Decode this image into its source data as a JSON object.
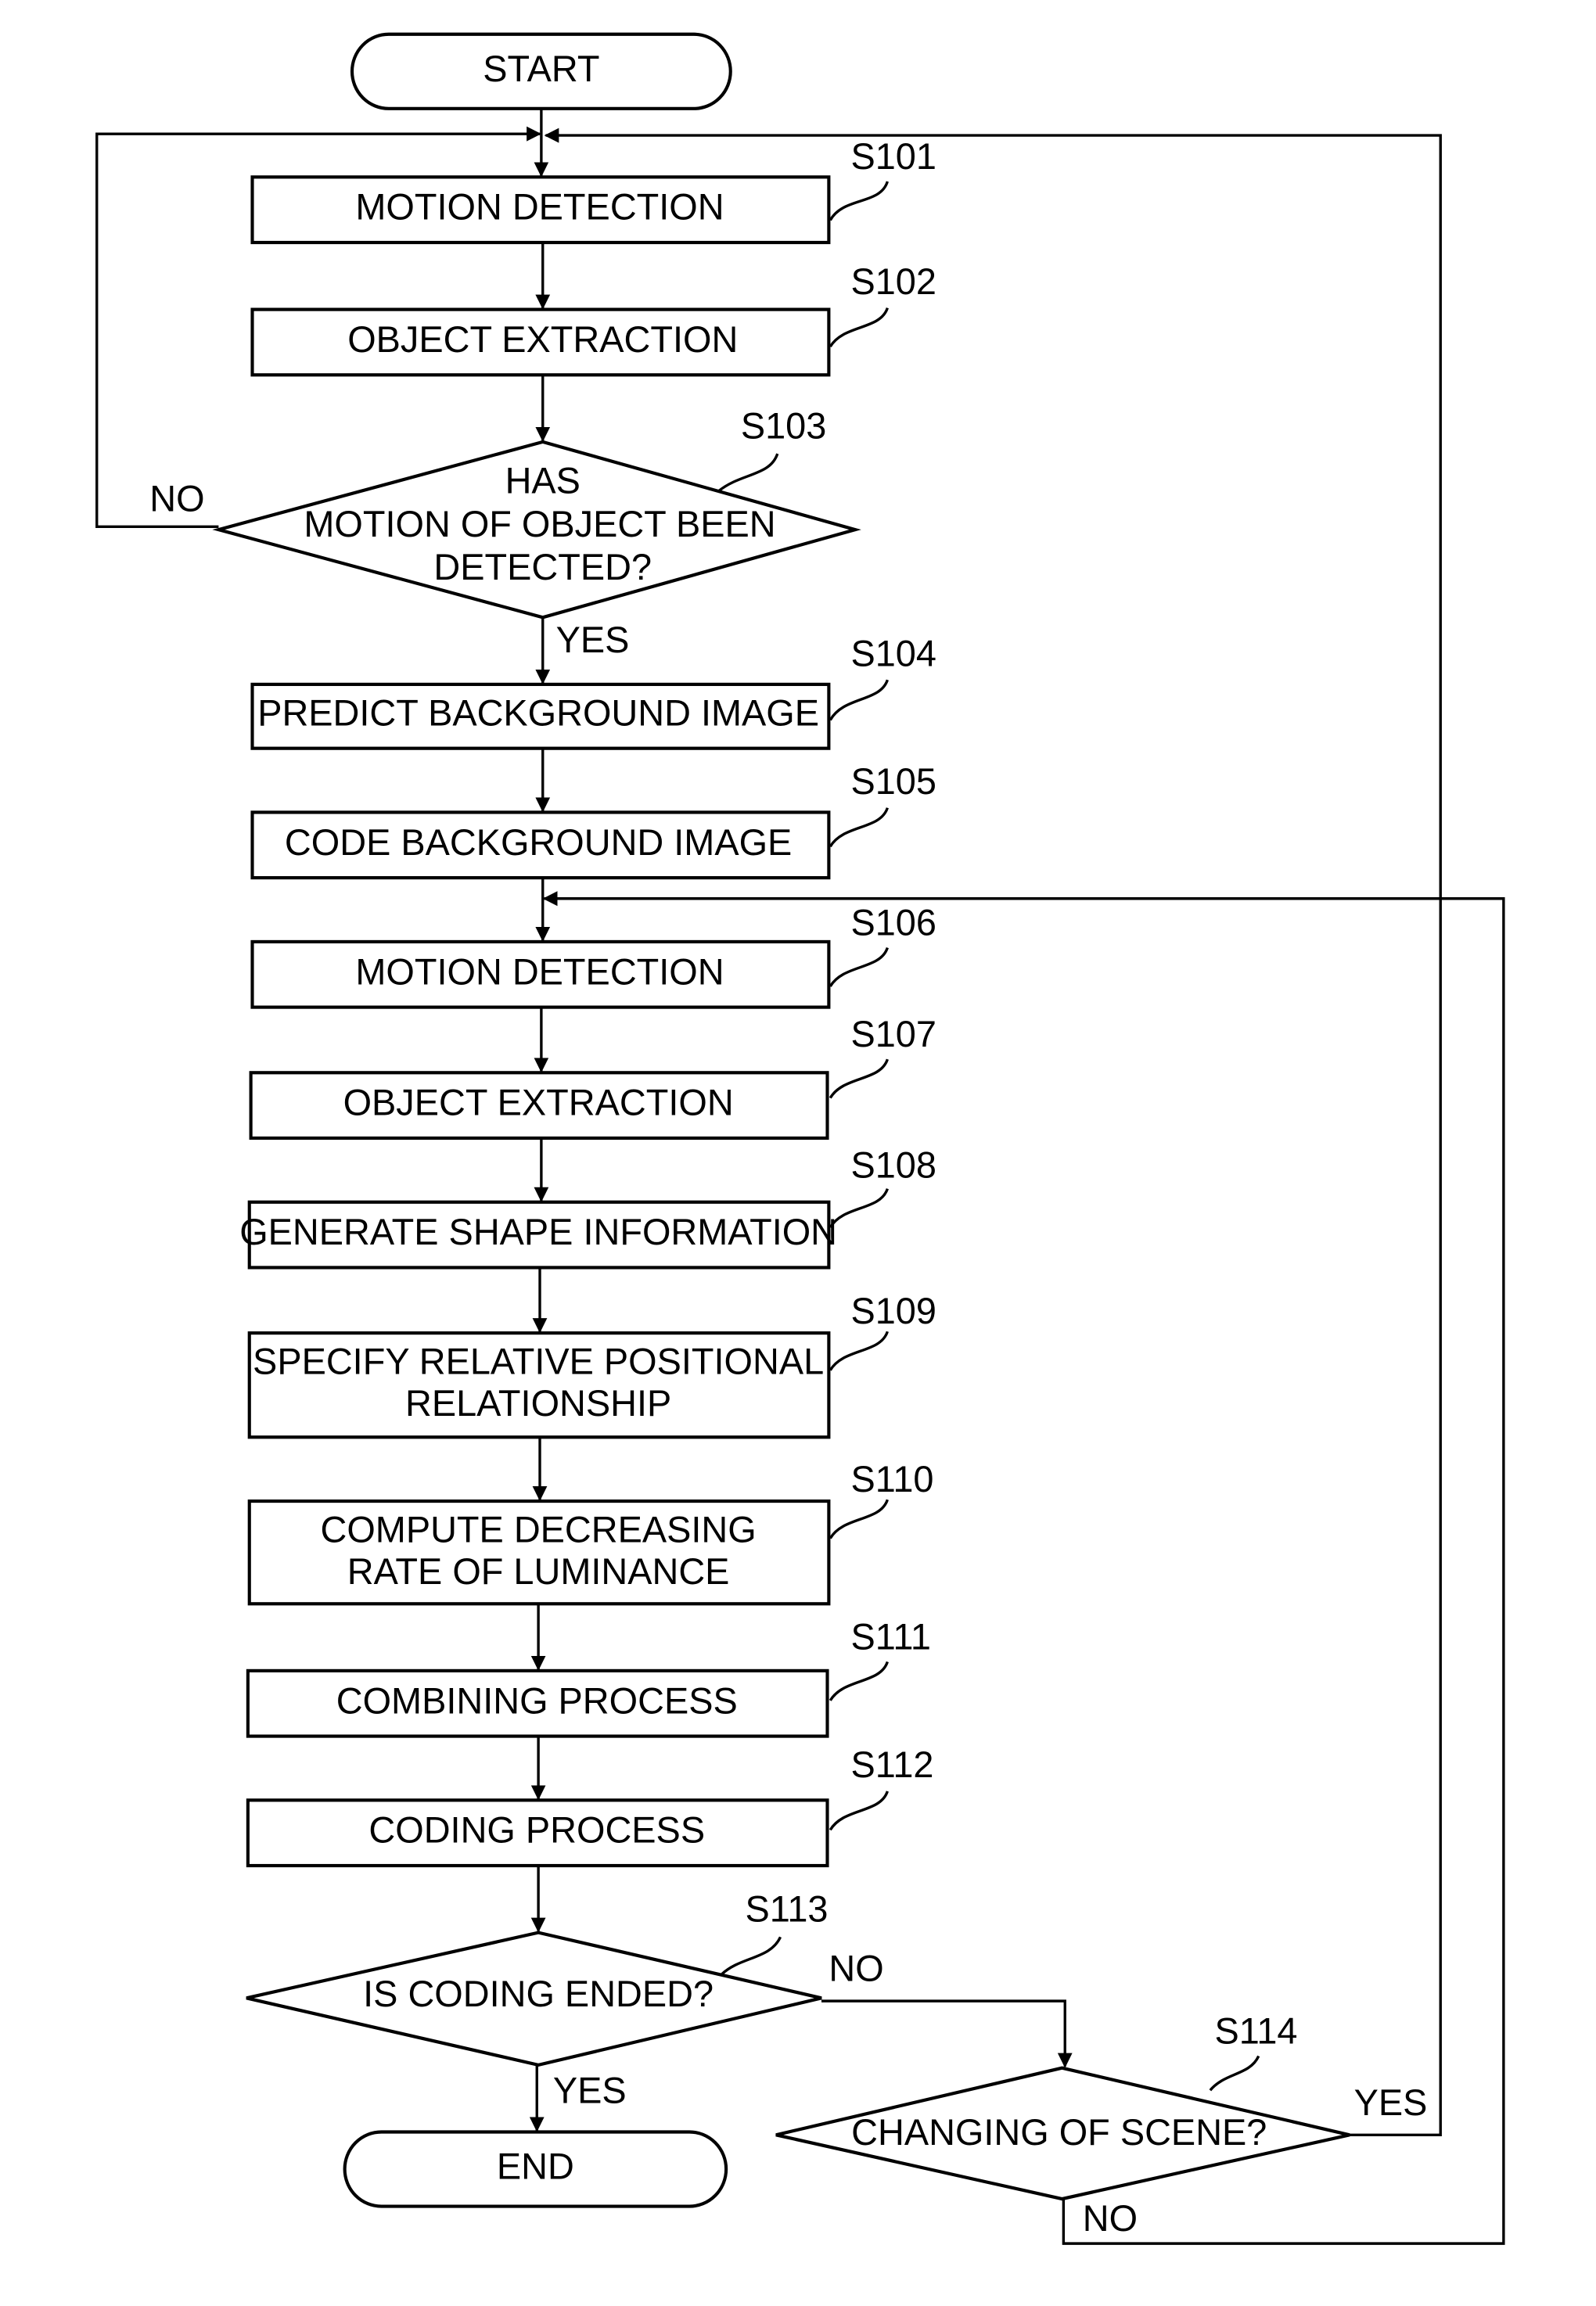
{
  "terminals": {
    "start": "START",
    "end": "END"
  },
  "steps": [
    {
      "id": "S101",
      "lines": [
        "MOTION DETECTION"
      ]
    },
    {
      "id": "S102",
      "lines": [
        "OBJECT EXTRACTION"
      ]
    },
    {
      "id": "S103",
      "lines": [
        "HAS",
        "MOTION OF OBJECT BEEN",
        "DETECTED?"
      ],
      "decision": true
    },
    {
      "id": "S104",
      "lines": [
        "PREDICT BACKGROUND IMAGE"
      ]
    },
    {
      "id": "S105",
      "lines": [
        "CODE BACKGROUND IMAGE"
      ]
    },
    {
      "id": "S106",
      "lines": [
        "MOTION DETECTION"
      ]
    },
    {
      "id": "S107",
      "lines": [
        "OBJECT EXTRACTION"
      ]
    },
    {
      "id": "S108",
      "lines": [
        "GENERATE SHAPE INFORMATION"
      ]
    },
    {
      "id": "S109",
      "lines": [
        "SPECIFY RELATIVE POSITIONAL",
        "RELATIONSHIP"
      ]
    },
    {
      "id": "S110",
      "lines": [
        "COMPUTE DECREASING",
        "RATE OF LUMINANCE"
      ]
    },
    {
      "id": "S111",
      "lines": [
        "COMBINING PROCESS"
      ]
    },
    {
      "id": "S112",
      "lines": [
        "CODING PROCESS"
      ]
    },
    {
      "id": "S113",
      "lines": [
        "IS CODING ENDED?"
      ],
      "decision": true
    },
    {
      "id": "S114",
      "lines": [
        "CHANGING OF SCENE?"
      ],
      "decision": true
    }
  ],
  "branches": {
    "s103_no": "NO",
    "s103_yes": "YES",
    "s113_no": "NO",
    "s113_yes": "YES",
    "s114_yes": "YES",
    "s114_no": "NO"
  }
}
